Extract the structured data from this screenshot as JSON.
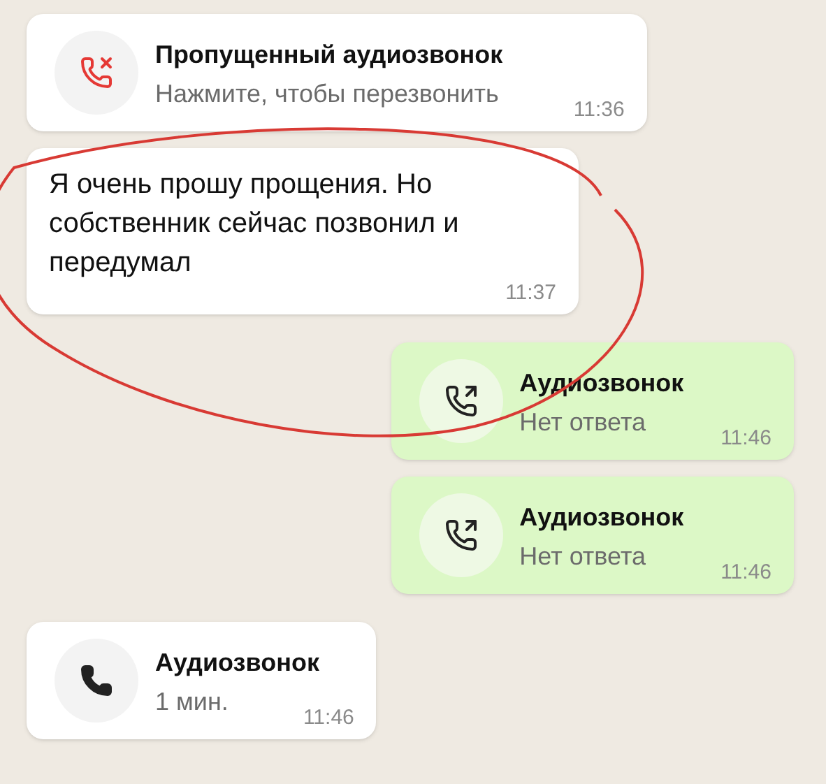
{
  "messages": [
    {
      "kind": "missed",
      "title": "Пропущенный аудиозвонок",
      "subtitle": "Нажмите, чтобы перезвонить",
      "time": "11:36"
    },
    {
      "kind": "text",
      "text": "Я очень прошу прощения. Но собственник сейчас позвонил и передумал",
      "time": "11:37"
    },
    {
      "kind": "outgoing",
      "title": "Аудиозвонок",
      "subtitle": "Нет ответа",
      "time": "11:46"
    },
    {
      "kind": "outgoing",
      "title": "Аудиозвонок",
      "subtitle": "Нет ответа",
      "time": "11:46"
    },
    {
      "kind": "incoming",
      "title": "Аудиозвонок",
      "subtitle": "1 мин.",
      "time": "11:46"
    }
  ]
}
